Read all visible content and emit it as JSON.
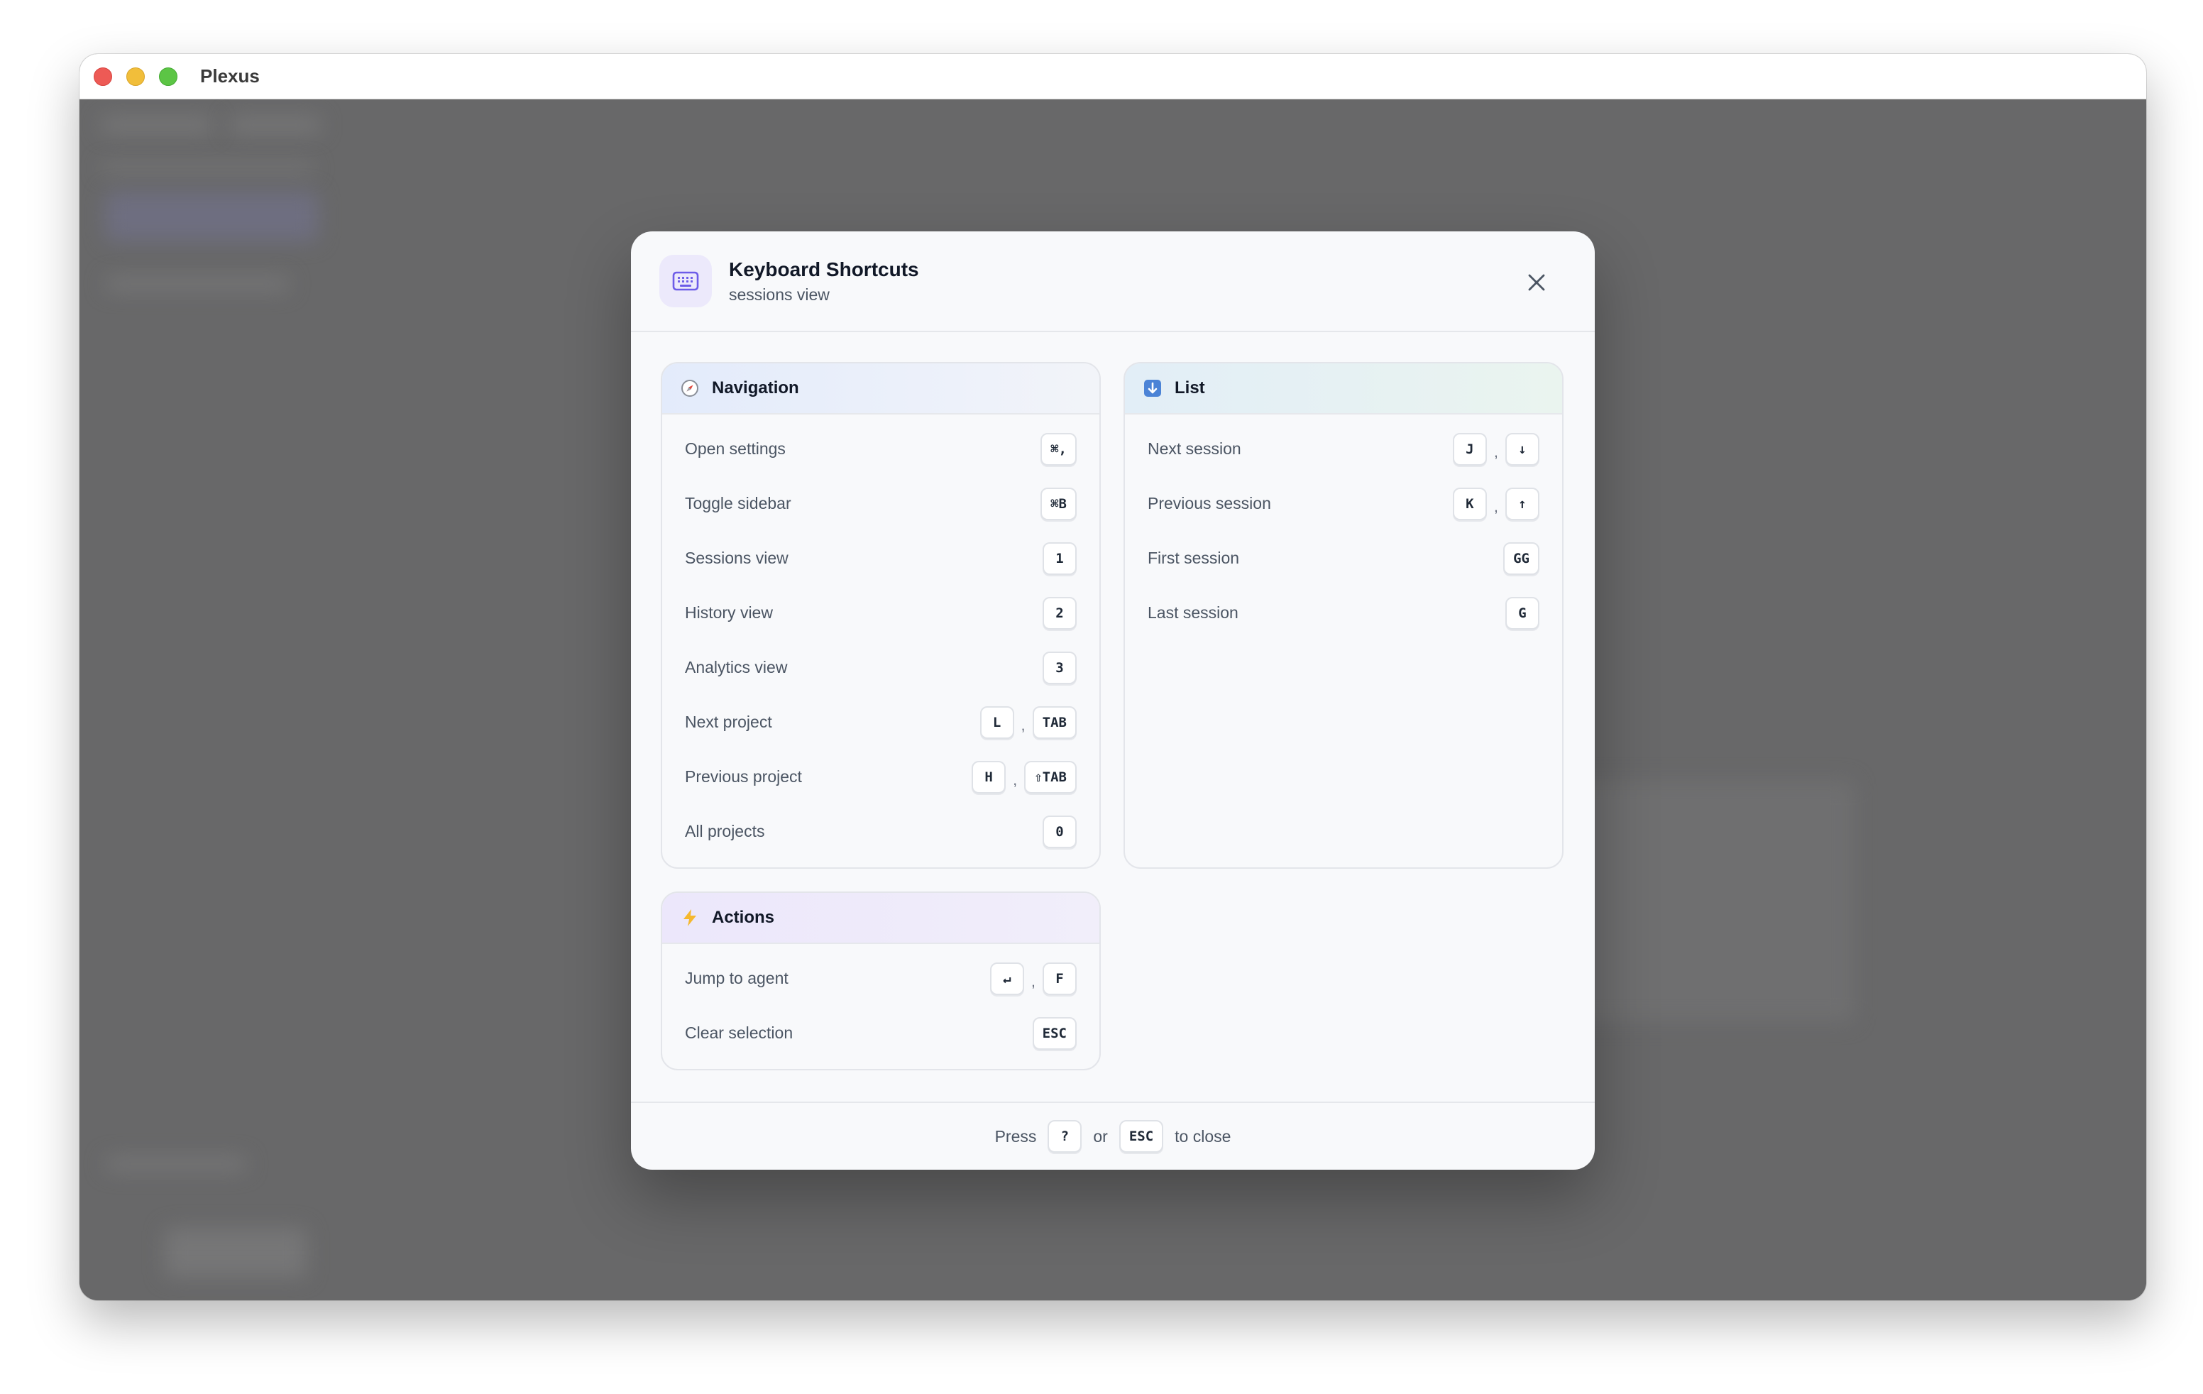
{
  "window": {
    "title": "Plexus"
  },
  "modal": {
    "title": "Keyboard Shortcuts",
    "subtitle": "sessions view",
    "icon": "keyboard-icon"
  },
  "navigation": {
    "title": "Navigation",
    "icon": "compass-icon",
    "items": [
      {
        "label": "Open settings",
        "keys": [
          "⌘,"
        ]
      },
      {
        "label": "Toggle sidebar",
        "keys": [
          "⌘B"
        ]
      },
      {
        "label": "Sessions view",
        "keys": [
          "1"
        ]
      },
      {
        "label": "History view",
        "keys": [
          "2"
        ]
      },
      {
        "label": "Analytics view",
        "keys": [
          "3"
        ]
      },
      {
        "label": "Next project",
        "keys": [
          "L",
          "TAB"
        ]
      },
      {
        "label": "Previous project",
        "keys": [
          "H",
          "⇧TAB"
        ]
      },
      {
        "label": "All projects",
        "keys": [
          "0"
        ]
      }
    ]
  },
  "list": {
    "title": "List",
    "icon": "sort-down-icon",
    "items": [
      {
        "label": "Next session",
        "keys": [
          "J",
          "↓"
        ]
      },
      {
        "label": "Previous session",
        "keys": [
          "K",
          "↑"
        ]
      },
      {
        "label": "First session",
        "keys": [
          "GG"
        ]
      },
      {
        "label": "Last session",
        "keys": [
          "G"
        ]
      }
    ]
  },
  "actions": {
    "title": "Actions",
    "icon": "lightning-icon",
    "items": [
      {
        "label": "Jump to agent",
        "keys": [
          "↵",
          "F"
        ]
      },
      {
        "label": "Clear selection",
        "keys": [
          "ESC"
        ]
      }
    ]
  },
  "footer": {
    "press": "Press",
    "key1": "?",
    "or": "or",
    "key2": "ESC",
    "to_close": "to close"
  },
  "separator": ",",
  "colors": {
    "backdrop": "#686869",
    "modal_bg": "#f8f9fb",
    "accent": "#6d5ce8",
    "lightning": "#f5b82e"
  }
}
